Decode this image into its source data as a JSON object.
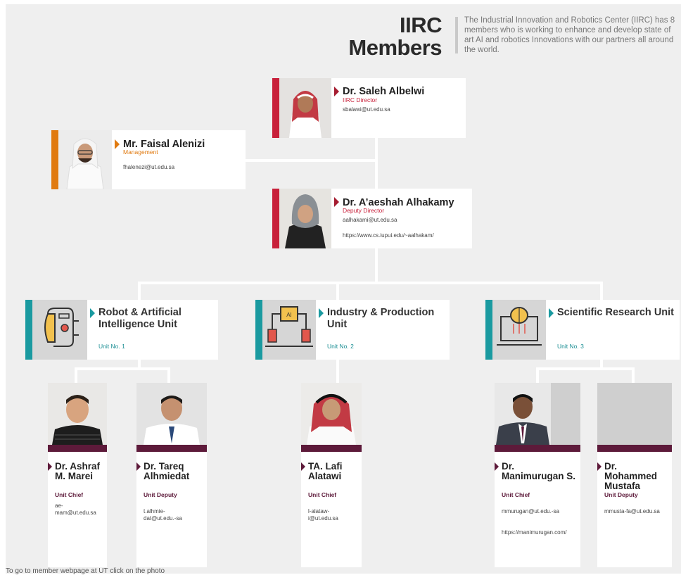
{
  "header": {
    "title_line1": "IIRC",
    "title_line2": "Members",
    "description": "The Industrial Innovation and Robotics Center (IIRC) has 8 members who is working to enhance and develop state of art AI and robotics Innovations with our partners all around the world."
  },
  "director": {
    "name": "Dr. Saleh Albelwi",
    "role": "IIRC Director",
    "email": "sbalawi@ut.edu.sa"
  },
  "management": {
    "name": "Mr. Faisal Alenizi",
    "role": "Management",
    "email": "fhalenezi@ut.edu.sa"
  },
  "deputy": {
    "name": "Dr. A’aeshah Alhakamy",
    "role": "Deputy Director",
    "email": "aalhakami@ut.edu.sa",
    "url": "https://www.cs.iupui.edu/~aalhakam/"
  },
  "units": [
    {
      "title": "Robot & Artificial Intelligence Unit",
      "number": "Unit No. 1",
      "icon": "robot-head-icon"
    },
    {
      "title": "Industry & Production Unit",
      "number": "Unit No. 2",
      "icon": "robotic-arms-icon"
    },
    {
      "title": "Scientific Research Unit",
      "number": "Unit No. 3",
      "icon": "brain-laptop-icon"
    }
  ],
  "members": [
    {
      "name": "Dr. Ashraf M. Marei",
      "role": "Unit Chief",
      "email": "ae-mam@ut.edu.sa"
    },
    {
      "name": "Dr. Tareq Alhmiedat",
      "role": "Unit Deputy",
      "email": "t.alhmie-dat@ut.edu.-sa"
    },
    {
      "name": "TA. Lafi Alatawi",
      "role": "Unit Chief",
      "email": "l-alataw-i@ut.edu.sa"
    },
    {
      "name": "Dr. Manimurugan S.",
      "role": "Unit Chief",
      "email": "mmurugan@ut.edu.-sa",
      "url": "https://manimurugan.com/"
    },
    {
      "name": "Dr. Mohammed Mustafa",
      "role": "Unit Deputy",
      "email": "mmusta-fa@ut.edu.sa"
    }
  ],
  "footer": "To go to member webpage at UT click on the photo",
  "colors": {
    "director": "#c8203a",
    "management": "#e07a10",
    "unit": "#1a9aa0",
    "member": "#5d1a3a",
    "deputy": "#c8203a"
  }
}
